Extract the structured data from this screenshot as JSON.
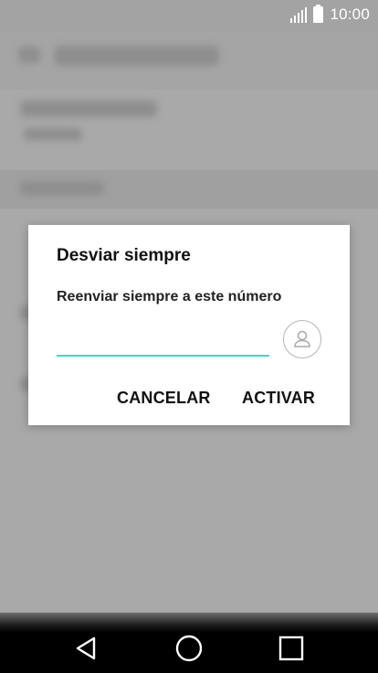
{
  "status_bar": {
    "time": "10:00",
    "signal_icon": "signal-icon",
    "battery_icon": "battery-icon"
  },
  "dialog": {
    "title": "Desviar siempre",
    "message": "Reenviar siempre a este número",
    "number_input": {
      "value": "",
      "placeholder": ""
    },
    "contact_icon": "contact-picker-icon",
    "cancel_label": "CANCELAR",
    "activate_label": "ACTIVAR",
    "accent_color": "#4fd1bf"
  },
  "nav_bar": {
    "back_icon": "back-icon",
    "home_icon": "home-icon",
    "recents_icon": "recents-icon"
  }
}
